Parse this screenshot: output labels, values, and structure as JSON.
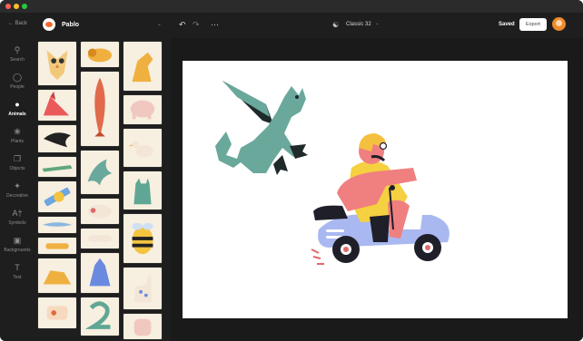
{
  "window": {
    "controls": [
      "close",
      "minimize",
      "maximize"
    ]
  },
  "sidebar": {
    "back_label": "Back",
    "items": [
      {
        "label": "Search",
        "icon": "search-icon",
        "active": false
      },
      {
        "label": "People",
        "icon": "person-icon",
        "active": false
      },
      {
        "label": "Animals",
        "icon": "paw-icon",
        "active": true
      },
      {
        "label": "Plants",
        "icon": "plant-icon",
        "active": false
      },
      {
        "label": "Objects",
        "icon": "objects-icon",
        "active": false
      },
      {
        "label": "Decorative",
        "icon": "sparkle-icon",
        "active": false
      },
      {
        "label": "Symbols",
        "icon": "symbols-icon",
        "active": false
      },
      {
        "label": "Backgrounds",
        "icon": "image-icon",
        "active": false
      },
      {
        "label": "Text",
        "icon": "text-icon",
        "active": false
      }
    ]
  },
  "pack": {
    "name": "Pablo"
  },
  "gallery": {
    "tiles": [
      "owl",
      "lion",
      "horse",
      "fox",
      "fish",
      "elephant",
      "crow",
      "bird",
      "crocodile",
      "dragon",
      "cat",
      "pencil",
      "sheep",
      "bee",
      "shark",
      "cheetah",
      "dog",
      "donkey",
      "giraffe",
      "snake",
      "bird-cage"
    ]
  },
  "toolbar": {
    "undo_icon": "undo-icon",
    "redo_icon": "redo-icon",
    "more_icon": "more-icon",
    "layout_name": "Classic 32",
    "saved_label": "Saved",
    "export_label": "Export"
  },
  "canvas": {
    "background": "#ffffff",
    "illustrations": [
      "dragon",
      "scooter-rider"
    ]
  },
  "colors": {
    "app_bg": "#1e1e1e",
    "tile_bg": "#f7efe0",
    "dragon": "#6aa89c",
    "scooter": "#a9b8f0",
    "jacket": "#f08080",
    "shirt": "#f5d040",
    "accent": "#f06a2a"
  }
}
